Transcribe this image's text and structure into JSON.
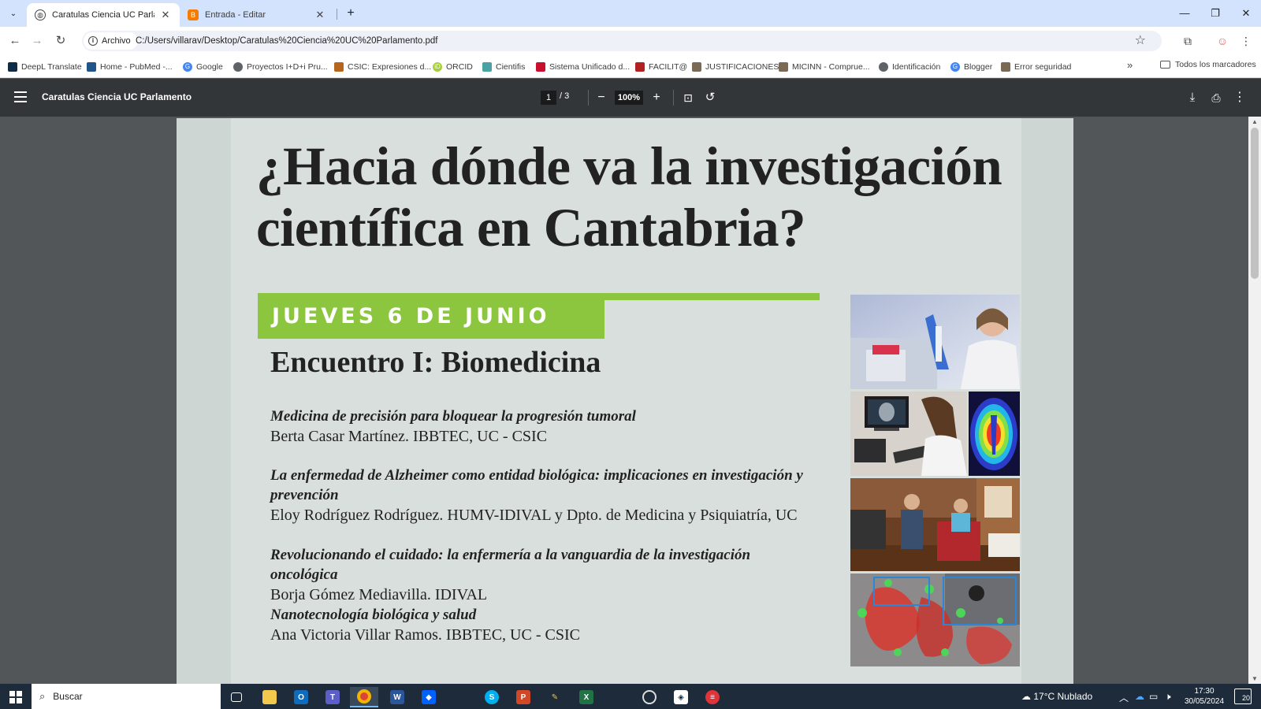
{
  "browser": {
    "tabs": [
      {
        "title": "Caratulas Ciencia UC Parlamento",
        "active": true
      },
      {
        "title": "Entrada - Editar",
        "active": false
      }
    ],
    "new_tab_label": "+",
    "omnibox": {
      "chip": "Archivo",
      "url": "C:/Users/villarav/Desktop/Caratulas%20Ciencia%20UC%20Parlamento.pdf"
    },
    "bookmarks": [
      {
        "label": "DeepL Translate",
        "color": "#0f2b46"
      },
      {
        "label": "Home - PubMed -...",
        "color": "#20558a"
      },
      {
        "label": "Google",
        "color": "#4285f4"
      },
      {
        "label": "Proyectos I+D+i Pru...",
        "color": "#5f6368"
      },
      {
        "label": "CSIC: Expresiones d...",
        "color": "#b5651d"
      },
      {
        "label": "ORCID",
        "color": "#a6ce39"
      },
      {
        "label": "Cientifis",
        "color": "#4aa3a2"
      },
      {
        "label": "Sistema Unificado d...",
        "color": "#c8102e"
      },
      {
        "label": "FACILIT@",
        "color": "#b22222"
      },
      {
        "label": "JUSTIFICACIONES",
        "color": "#7a6a55"
      },
      {
        "label": "MICINN - Comprue...",
        "color": "#7a6a55"
      },
      {
        "label": "Identificación",
        "color": "#5f6368"
      },
      {
        "label": "Blogger",
        "color": "#4285f4"
      },
      {
        "label": "Error seguridad",
        "color": "#7a6a55"
      }
    ],
    "bookmarks_more": "»",
    "all_bookmarks": "Todos los marcadores"
  },
  "pdf": {
    "title": "Caratulas Ciencia UC Parlamento",
    "page_current": "1",
    "page_total": "/ 3",
    "zoom": "100%"
  },
  "poster": {
    "headline_line1": "¿Hacia dónde va la investigación",
    "headline_line2": "científica en Cantabria?",
    "date": "JUEVES 6 DE JUNIO",
    "encuentro": "Encuentro I: Biomedicina",
    "accent_color": "#8cc63f",
    "talks": [
      {
        "title": "Medicina de precisión para bloquear la progresión tumoral",
        "speaker": "Berta Casar Martínez. IBBTEC, UC - CSIC"
      },
      {
        "title": "La enfermedad de Alzheimer como entidad biológica: implicaciones en investigación y prevención",
        "speaker": "Eloy Rodríguez Rodríguez. HUMV-IDIVAL y Dpto. de Medicina y Psiquiatría, UC"
      },
      {
        "title": "Revolucionando el cuidado:  la enfermería a la vanguardia de la investigación oncológica",
        "speaker": "Borja Gómez Mediavilla. IDIVAL"
      },
      {
        "title": "Nanotecnología biológica y salud",
        "speaker": "Ana Victoria Villar Ramos. IBBTEC, UC - CSIC"
      }
    ]
  },
  "taskbar": {
    "search_placeholder": "Buscar",
    "weather": "17°C  Nublado",
    "time": "17:30",
    "date": "30/05/2024",
    "notifications": "20"
  }
}
